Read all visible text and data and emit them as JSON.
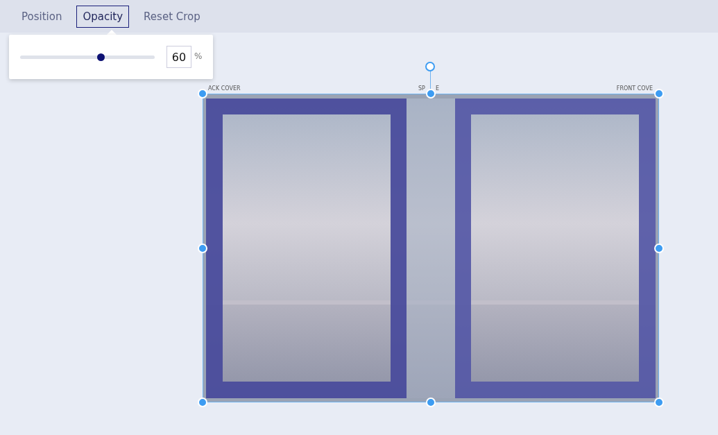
{
  "tabs": [
    {
      "label": "Position",
      "selected": false
    },
    {
      "label": "Opacity",
      "selected": true
    },
    {
      "label": "Reset Crop",
      "selected": false
    }
  ],
  "opacity_popup": {
    "slider": {
      "level": 0.6
    },
    "value": "60",
    "unit": "%"
  },
  "canvas": {
    "back_cover_label": "ACK COVER",
    "spine_label": [
      "SP",
      "E"
    ],
    "front_cover_label": "FRONT COVE",
    "image": {
      "kind": "picture"
    }
  }
}
